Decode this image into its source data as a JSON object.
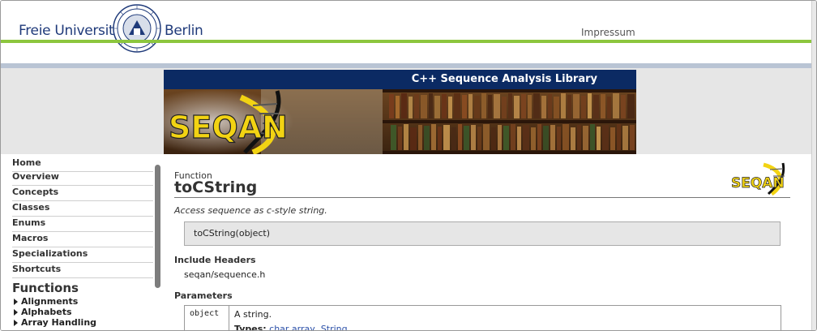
{
  "header": {
    "univ_left": "Freie Universität",
    "univ_right": "Berlin",
    "impressum": "Impressum"
  },
  "banner": {
    "title": "C++ Sequence Analysis Library",
    "logo_text": "SEQAN"
  },
  "sidebar": {
    "items": [
      {
        "label": "Home"
      },
      {
        "label": "Overview"
      },
      {
        "label": "Concepts"
      },
      {
        "label": "Classes"
      },
      {
        "label": "Enums"
      },
      {
        "label": "Macros"
      },
      {
        "label": "Specializations"
      },
      {
        "label": "Shortcuts"
      }
    ],
    "functions_heading": "Functions",
    "functions": [
      {
        "label": "Alignments"
      },
      {
        "label": "Alphabets"
      },
      {
        "label": "Array Handling"
      }
    ]
  },
  "content": {
    "kind": "Function",
    "title": "toCString",
    "description": "Access sequence as c-style string.",
    "signature": "toCString(object)",
    "include_heading": "Include Headers",
    "include_value": "seqan/sequence.h",
    "params_heading": "Parameters",
    "params": [
      {
        "name": "object",
        "description": "A string.",
        "types_label": "Types:",
        "types": [
          "char array",
          "String"
        ]
      }
    ]
  },
  "colors": {
    "fu_blue": "#1f3a7a",
    "fu_green": "#8cc63e",
    "banner_blue": "#0b2a63",
    "seqan_yellow": "#f2d313"
  },
  "icons": [
    "fu-seal-icon",
    "seqan-logo-icon",
    "triangle-right-icon"
  ]
}
